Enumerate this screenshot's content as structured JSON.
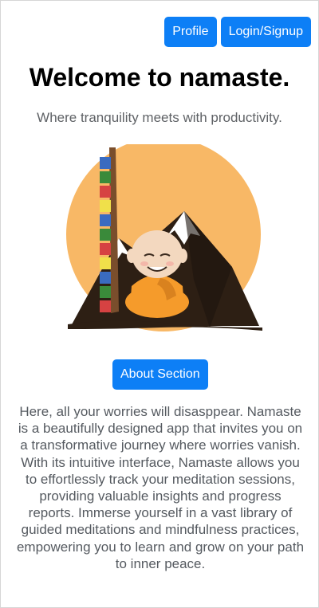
{
  "nav": {
    "profile_label": "Profile",
    "login_label": "Login/Signup"
  },
  "hero": {
    "title": "Welcome to namaste.",
    "subtitle": "Where tranquility meets with productivity."
  },
  "about": {
    "button_label": "About Section",
    "description": "Here, all your worries will disasppear. Namaste is a beautifully designed app that invites you on a transformative journey where worries vanish. With its intuitive interface, Namaste allows you to effortlessly track your meditation sessions, providing valuable insights and progress reports. Immerse yourself in a vast library of guided meditations and mindfulness practices, empowering you to learn and grow on your path to inner peace."
  },
  "colors": {
    "accent": "#0d7ff6",
    "sun": "#f8b866",
    "robe": "#f59b2b"
  },
  "illustration_icon": "meditating-monk-mountain-illustration"
}
